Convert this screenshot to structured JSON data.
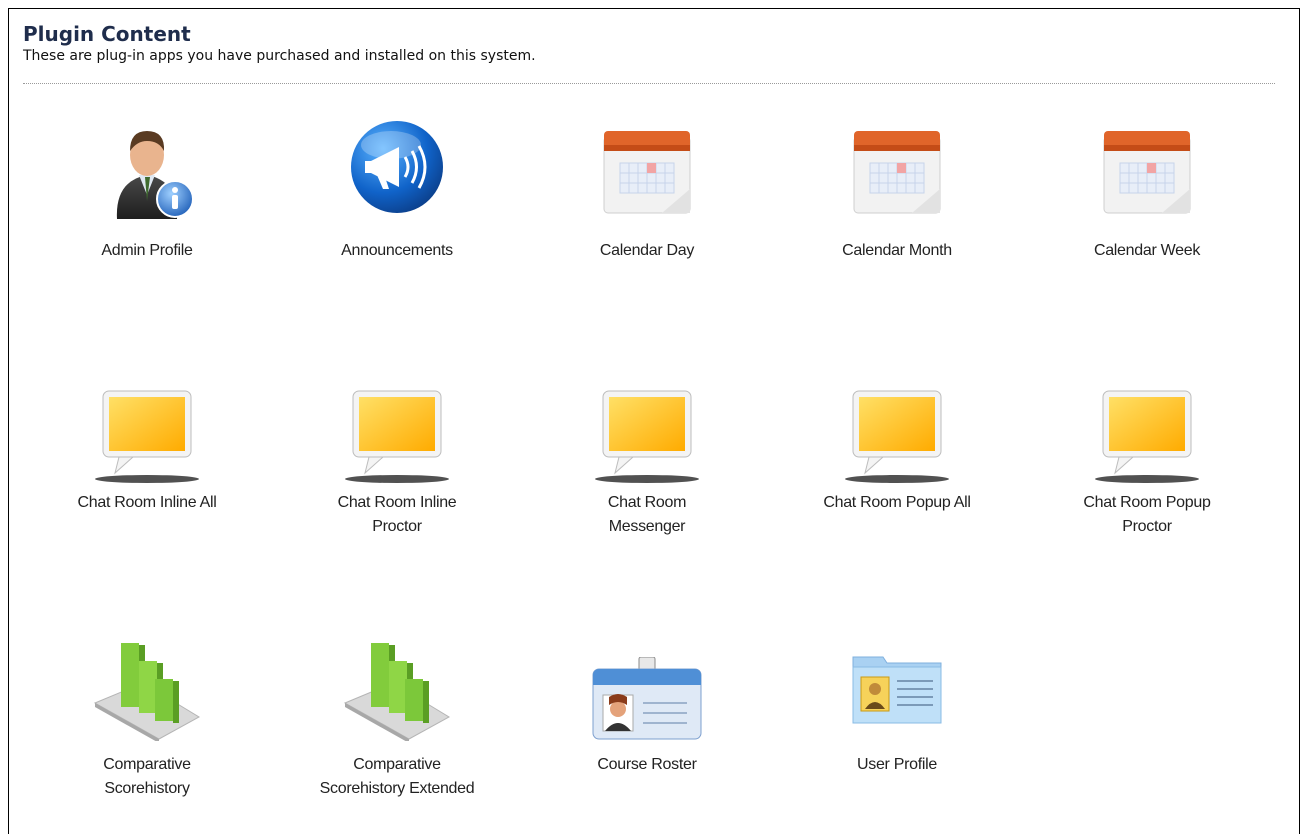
{
  "header": {
    "title": "Plugin Content",
    "subtitle": "These are plug-in apps you have purchased and installed on this system."
  },
  "plugins": [
    {
      "label": "Admin Profile",
      "icon": "admin-profile-icon"
    },
    {
      "label": "Announcements",
      "icon": "megaphone-icon"
    },
    {
      "label": "Calendar Day",
      "icon": "calendar-icon"
    },
    {
      "label": "Calendar Month",
      "icon": "calendar-icon"
    },
    {
      "label": "Calendar Week",
      "icon": "calendar-icon"
    },
    {
      "label": "Chat Room Inline All",
      "icon": "speech-bubble-icon"
    },
    {
      "label_lines": [
        "Chat Room Inline",
        "Proctor"
      ],
      "icon": "speech-bubble-icon"
    },
    {
      "label_lines": [
        "Chat Room",
        "Messenger"
      ],
      "icon": "speech-bubble-icon"
    },
    {
      "label": "Chat Room Popup All",
      "icon": "speech-bubble-icon"
    },
    {
      "label_lines": [
        "Chat Room Popup",
        "Proctor"
      ],
      "icon": "speech-bubble-icon"
    },
    {
      "label_lines": [
        "Comparative",
        "Scorehistory"
      ],
      "icon": "bar-chart-icon"
    },
    {
      "label_lines": [
        "Comparative",
        "Scorehistory Extended"
      ],
      "icon": "bar-chart-icon"
    },
    {
      "label": "Course Roster",
      "icon": "id-badge-icon"
    },
    {
      "label": "User Profile",
      "icon": "user-card-icon"
    }
  ],
  "colors": {
    "title": "#1f2d4c",
    "calendar_header": "#e0652a",
    "chat_fill": "#ffc21a",
    "chart_green": "#7cc83a",
    "badge_blue": "#4f8fd6"
  }
}
